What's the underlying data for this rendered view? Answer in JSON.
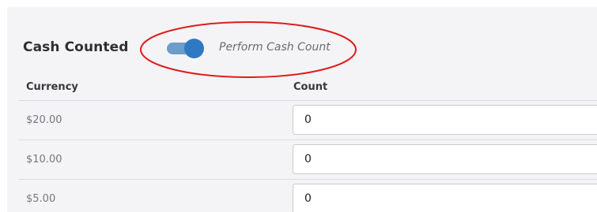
{
  "section": {
    "title": "Cash Counted",
    "toggle": {
      "label": "Perform Cash Count",
      "on": true
    }
  },
  "table": {
    "headers": {
      "currency": "Currency",
      "count": "Count"
    },
    "rows": [
      {
        "currency": "$20.00",
        "count": "0"
      },
      {
        "currency": "$10.00",
        "count": "0"
      },
      {
        "currency": "$5.00",
        "count": "0"
      }
    ]
  },
  "colors": {
    "background": "#f4f4f6",
    "toggle_track": "#6d9cc9",
    "toggle_knob": "#2f78c2",
    "annotation_ring": "#e01b1b"
  }
}
